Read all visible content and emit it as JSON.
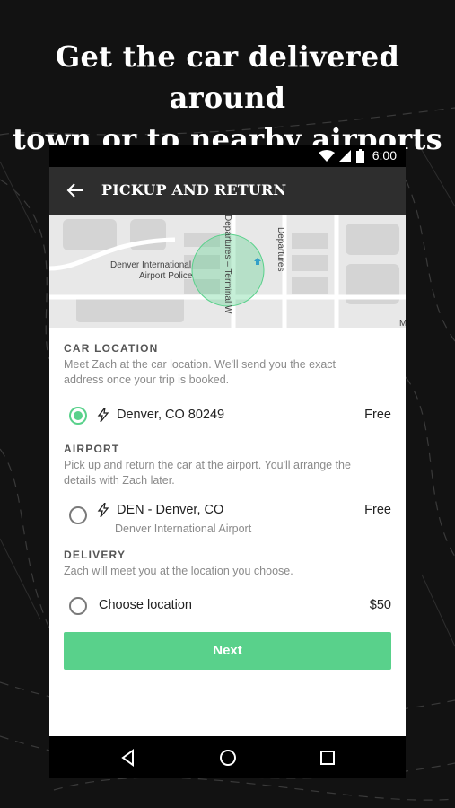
{
  "headline": [
    "Get the car delivered around",
    "town or to nearby airports"
  ],
  "status": {
    "time": "6:00"
  },
  "appbar": {
    "title": "PICKUP AND RETURN"
  },
  "map": {
    "label_police": [
      "Denver International",
      "Airport Police"
    ],
    "label_terminal": "Departures – Terminal W",
    "label_departures": "Departures",
    "label_edge": "M"
  },
  "sections": {
    "car_location": {
      "title": "CAR LOCATION",
      "desc": [
        "Meet Zach at the car location. We'll send you the exact",
        "address once your trip is booked."
      ],
      "option": {
        "label": "Denver, CO 80249",
        "price": "Free",
        "selected": true
      }
    },
    "airport": {
      "title": "AIRPORT",
      "desc": [
        "Pick up and return the car at the airport. You'll arrange the",
        "details with Zach later."
      ],
      "option": {
        "label": "DEN - Denver, CO",
        "sublabel": "Denver International Airport",
        "price": "Free",
        "selected": false
      }
    },
    "delivery": {
      "title": "DELIVERY",
      "desc": [
        "Zach will meet you at the location you choose."
      ],
      "option": {
        "label": "Choose location",
        "price": "$50",
        "selected": false
      }
    }
  },
  "next_button": {
    "label": "Next"
  },
  "colors": {
    "accent": "#59d18b",
    "appbar": "#2e2e2e",
    "background": "#121212"
  }
}
